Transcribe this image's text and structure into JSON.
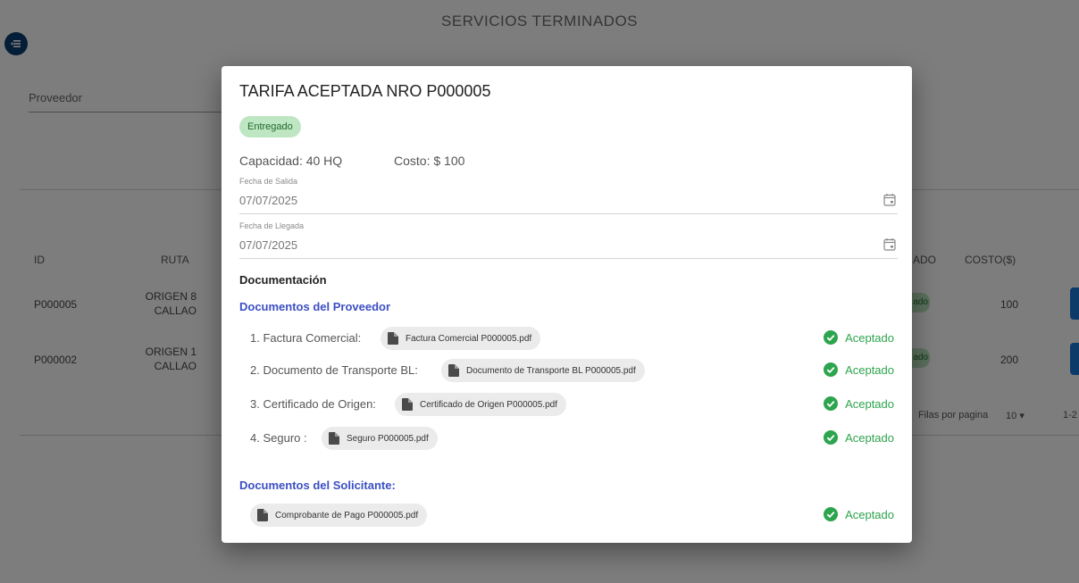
{
  "background": {
    "page_title": "SERVICIOS TERMINADOS",
    "filter_label": "Proveedor",
    "table": {
      "headers": {
        "id": "ID",
        "ruta": "RUTA",
        "estado_partial": "ADO",
        "costo": "COSTO($)"
      },
      "rows": [
        {
          "id": "P000005",
          "ruta_line1": "ORIGEN 8",
          "ruta_line2": "CALLAO",
          "status_partial": "ado",
          "costo": "100"
        },
        {
          "id": "P000002",
          "ruta_line1": "ORIGEN 1",
          "ruta_line2": "CALLAO",
          "status_partial": "ado",
          "costo": "200"
        }
      ]
    },
    "pagination": {
      "rows_label": "Filas por pagina",
      "rows_value": "10",
      "range_partial": "1-2"
    }
  },
  "modal": {
    "title": "TARIFA ACEPTADA NRO P000005",
    "status": "Entregado",
    "capacidad": "Capacidad: 40 HQ",
    "costo": "Costo: $ 100",
    "fecha_salida": {
      "label": "Fecha de Salida",
      "value": "07/07/2025"
    },
    "fecha_llegada": {
      "label": "Fecha de Llegada",
      "value": "07/07/2025"
    },
    "documentacion_title": "Documentación",
    "proveedor_title": "Documentos del Proveedor",
    "proveedor_docs": [
      {
        "label": "1. Factura Comercial:",
        "file": "Factura Comercial P000005.pdf",
        "status": "Aceptado"
      },
      {
        "label": "2. Documento de Transporte BL:",
        "file": "Documento de Transporte BL P000005.pdf",
        "status": "Aceptado"
      },
      {
        "label": "3. Certificado de Origen:",
        "file": "Certificado de Origen P000005.pdf",
        "status": "Aceptado"
      },
      {
        "label": "4. Seguro :",
        "file": "Seguro P000005.pdf",
        "status": "Aceptado"
      }
    ],
    "solicitante_title": "Documentos del Solicitante:",
    "solicitante_docs": [
      {
        "file": "Comprobante de Pago P000005.pdf",
        "status": "Aceptado"
      }
    ]
  },
  "colors": {
    "accent_blue": "#3c4fc4",
    "success_green": "#2da44e",
    "chip_green_bg": "#bfe6c3",
    "fab_navy": "#0b3d6e"
  },
  "icons": [
    "menu-icon",
    "calendar-icon",
    "file-icon",
    "check-circle-icon"
  ]
}
